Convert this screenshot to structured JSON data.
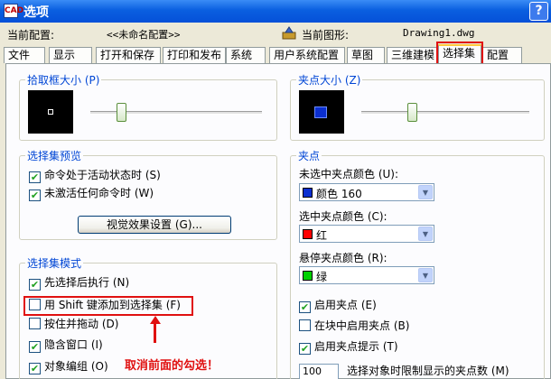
{
  "window": {
    "title": "选项",
    "help": "?",
    "icon": "CAD"
  },
  "config": {
    "current_config_label": "当前配置:",
    "current_config_value": "<<未命名配置>>",
    "current_drawing_label": "当前图形:",
    "current_drawing_value": "Drawing1.dwg"
  },
  "tabs": [
    "文件",
    "显示",
    "打开和保存",
    "打印和发布",
    "系统",
    "用户系统配置",
    "草图",
    "三维建模",
    "选择集",
    "配置"
  ],
  "active_tab": "选择集",
  "pickbox": {
    "title": "拾取框大小 (P)",
    "level": 0.18
  },
  "grip_size": {
    "title": "夹点大小 (Z)",
    "level": 0.3
  },
  "preview_group": {
    "title": "选择集预览",
    "items": [
      {
        "label": "命令处于活动状态时 (S)",
        "checked": true
      },
      {
        "label": "未激活任何命令时 (W)",
        "checked": true
      }
    ],
    "visual_button": "视觉效果设置 (G)..."
  },
  "selection_modes": {
    "title": "选择集模式",
    "items": [
      {
        "label": "先选择后执行 (N)",
        "checked": true
      },
      {
        "label": "用 Shift 键添加到选择集 (F)",
        "checked": false
      },
      {
        "label": "按住并拖动 (D)",
        "checked": false
      },
      {
        "label": "隐含窗口 (I)",
        "checked": true
      },
      {
        "label": "对象编组 (O)",
        "checked": true
      }
    ]
  },
  "grips": {
    "title": "夹点",
    "unselected_label": "未选中夹点颜色 (U):",
    "unselected_value": "颜色 160",
    "unselected_color": "#0b2fd0",
    "selected_label": "选中夹点颜色 (C):",
    "selected_value": "红",
    "selected_color": "#ff0000",
    "hover_label": "悬停夹点颜色 (R):",
    "hover_value": "绿",
    "hover_color": "#00d000",
    "enable_grips": "启用夹点 (E)",
    "enable_grips_checked": true,
    "enable_in_blocks": "在块中启用夹点 (B)",
    "enable_in_blocks_checked": false,
    "enable_tips": "启用夹点提示 (T)",
    "enable_tips_checked": true,
    "limit_value": "100",
    "limit_label": "选择对象时限制显示的夹点数 (M)"
  },
  "annotation": {
    "text": "取消前面的勾选！",
    "color": "#e01010"
  }
}
